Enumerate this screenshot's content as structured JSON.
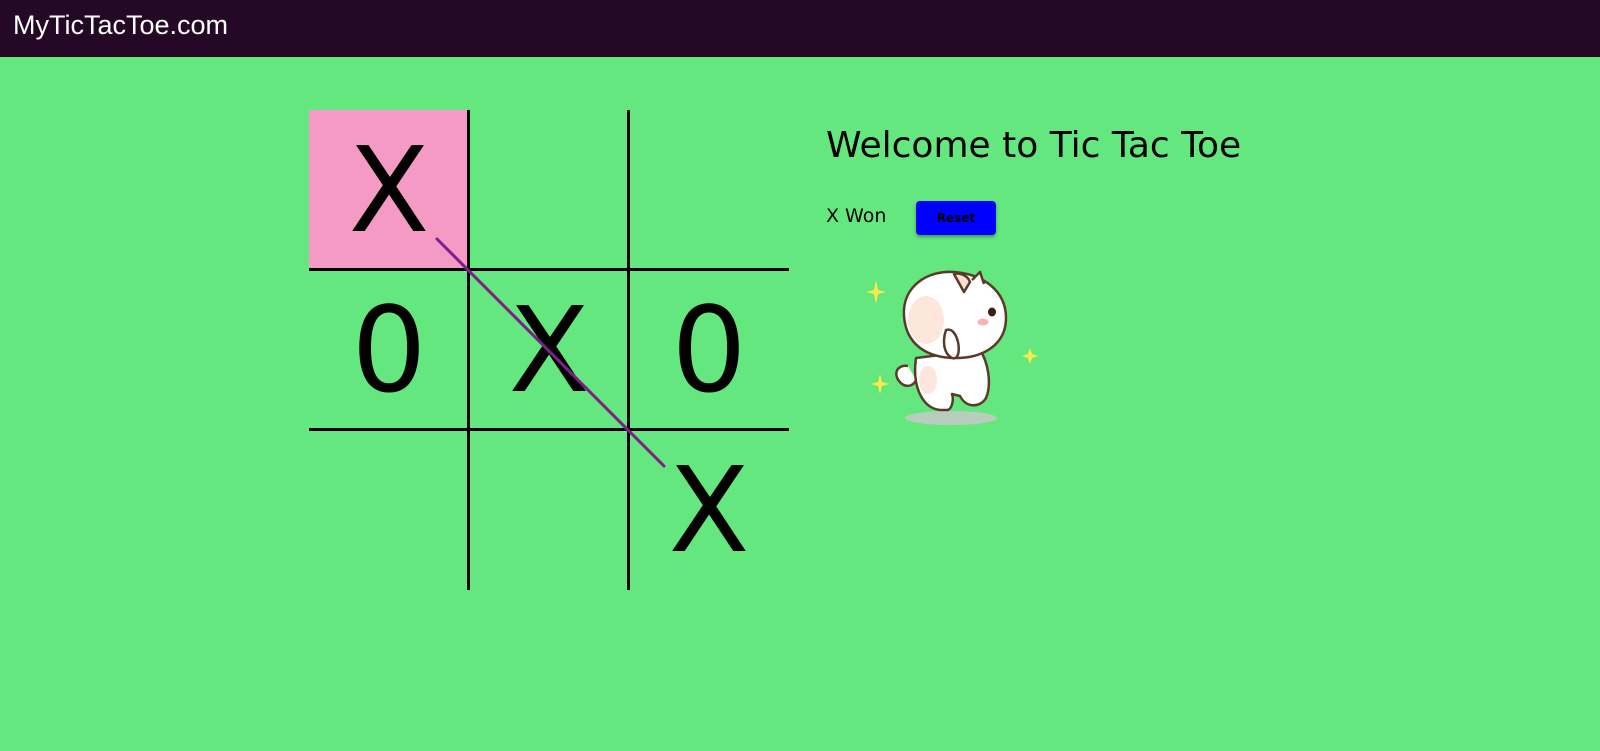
{
  "navbar": {
    "brand": "MyTicTacToe.com"
  },
  "game": {
    "title": "Welcome to Tic Tac Toe",
    "status": "X Won",
    "reset_label": "Reset",
    "board": [
      "X",
      "",
      "",
      "0",
      "X",
      "0",
      "",
      "",
      "X"
    ],
    "winning_cells": [
      0,
      4,
      8
    ],
    "winner": "X"
  },
  "colors": {
    "page_background": "#63e77e",
    "navbar_background": "#240826",
    "highlight_cell": "#f49ac5",
    "win_line": "#7b2089",
    "reset_button": "#0000ff"
  },
  "images": {
    "mascot": "happy-cat-illustration"
  }
}
